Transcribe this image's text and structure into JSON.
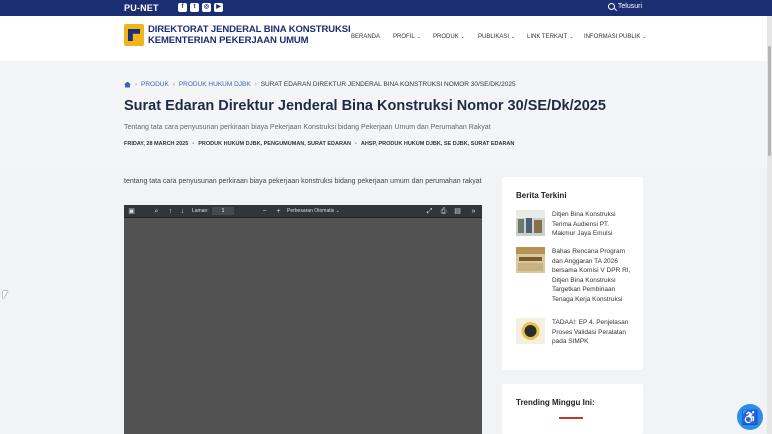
{
  "topbar": {
    "brand": "PU-NET",
    "search_label": "Telusuri",
    "social": [
      "facebook-icon",
      "twitter-icon",
      "instagram-icon",
      "youtube-icon"
    ]
  },
  "header": {
    "logo_line1": "DIREKTORAT JENDERAL BINA KONSTRUKSI",
    "logo_line2": "KEMENTERIAN PEKERJAAN UMUM",
    "nav": [
      {
        "label": "BERANDA"
      },
      {
        "label": "PROFIL",
        "dropdown": true
      },
      {
        "label": "PRODUK",
        "dropdown": true
      },
      {
        "label": "PUBLIKASI",
        "dropdown": true
      },
      {
        "label": "LINK TERKAIT",
        "dropdown": true
      },
      {
        "label": "INFORMASI PUBLIK",
        "dropdown": true
      }
    ]
  },
  "breadcrumb": {
    "items": [
      "PRODUK",
      "PRODUK HUKUM DJBK",
      "SURAT EDARAN DIREKTUR JENDERAL BINA KONSTRUKSI NOMOR 30/SE/DK/2025"
    ]
  },
  "page": {
    "title": "Surat Edaran Direktur Jenderal Bina Konstruksi Nomor 30/SE/Dk/2025",
    "subtitle": "Tentang tata cara penyusunan perkiraan biaya Pekerjaan Konstruksi bidang Pekerjaan Umum dan Perumahan Rakyat",
    "date": "FRIDAY, 28 MARCH 2025",
    "categories": "PRODUK HUKUM DJBK, PENGUMUMAN, SURAT EDARAN",
    "tags": "AHSP, PRODUK HUKUM DJBK, SE DJBK, SURAT EDARAN",
    "body": "tentang tata cara penyusunan perkiraan biaya pekerjaan konstruksi bidang pekerjaan umum dan perumahan rakyat"
  },
  "pdf_viewer": {
    "page_label": "Laman:",
    "page_value": "1",
    "zoom_label": "Perbesaran Otomatis"
  },
  "sidebar": {
    "news_title": "Berita Terkini",
    "news": [
      {
        "text": "Ditjen Bina Konstruksi Terima Audiensi PT. Makmur Jaya Emulsi"
      },
      {
        "text": "Bahas Rencana Program dan Anggaran TA 2026 bersama Komisi V DPR RI, Ditjen Bina Konstruksi Targetkan Pembinaan Tenaga Kerja Konstruksi"
      },
      {
        "text": "TADAA!: EP 4. Penjelasan Proses Validasi Peralatan pada SIMPK"
      }
    ],
    "trending_title": "Trending Minggu Ini:"
  },
  "colors": {
    "brand_navy": "#1b2e74",
    "link_blue": "#3a64b7",
    "accent_red": "#c0392b",
    "logo_yellow": "#f1b51c",
    "accessibility_blue": "#2b8fe8"
  }
}
